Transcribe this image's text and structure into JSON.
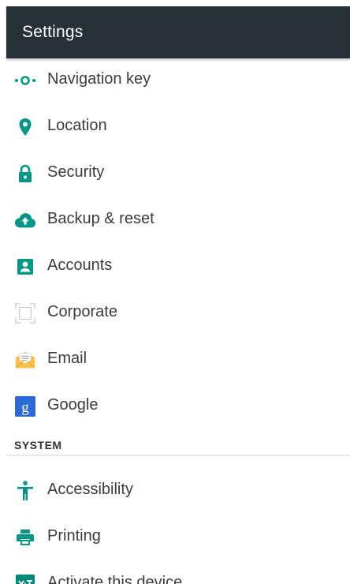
{
  "appbar": {
    "title": "Settings"
  },
  "colors": {
    "appbar_bg": "#263238",
    "accent": "#009688",
    "text": "#3c3c3c"
  },
  "items": [
    {
      "label": "Navigation key",
      "icon": "navigation-key-icon"
    },
    {
      "label": "Location",
      "icon": "location-pin-icon"
    },
    {
      "label": "Security",
      "icon": "lock-icon"
    },
    {
      "label": "Backup & reset",
      "icon": "cloud-upload-icon"
    },
    {
      "label": "Accounts",
      "icon": "account-box-icon"
    },
    {
      "label": "Corporate",
      "icon": "corporate-icon"
    },
    {
      "label": "Email",
      "icon": "email-envelope-icon"
    },
    {
      "label": "Google",
      "icon": "google-g-icon"
    }
  ],
  "system_section": {
    "title": "SYSTEM",
    "items": [
      {
        "label": "Accessibility",
        "icon": "accessibility-icon"
      },
      {
        "label": "Printing",
        "icon": "printer-icon"
      },
      {
        "label": "Activate this device",
        "icon": "activate-device-icon"
      }
    ]
  }
}
